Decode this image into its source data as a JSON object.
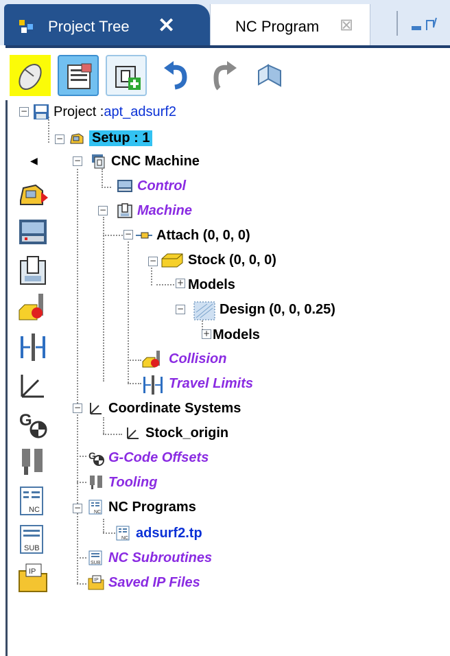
{
  "tabs": [
    {
      "label": "Project Tree",
      "close": "✕",
      "active": true
    },
    {
      "label": "NC Program",
      "close": "⊠",
      "active": false
    }
  ],
  "toolbar": [
    "mouse-select",
    "info",
    "add-machine",
    "undo",
    "redo",
    "shapes"
  ],
  "tree": {
    "project_prefix": "Project : ",
    "project_name": "apt_adsurf2",
    "setup": "Setup : 1",
    "cnc_machine": "CNC Machine",
    "control": "Control",
    "machine": "Machine",
    "attach": "Attach (0, 0, 0)",
    "stock": "Stock (0, 0, 0)",
    "stock_models": "Models",
    "design": "Design (0, 0, 0.25)",
    "design_models": "Models",
    "collision": "Collision",
    "travel_limits": "Travel Limits",
    "coordinate_systems": "Coordinate Systems",
    "stock_origin": "Stock_origin",
    "gcode_offsets": "G-Code Offsets",
    "tooling": "Tooling",
    "nc_programs": "NC Programs",
    "nc_program_file": "adsurf2.tp",
    "nc_subroutines": "NC Subroutines",
    "saved_ip_files": "Saved IP Files"
  },
  "toggles": {
    "expanded": "−",
    "collapsed": "+"
  },
  "palette": {
    "collapse": "◀",
    "items": [
      "setup-icon",
      "control-icon",
      "machine-icon",
      "collision-icon",
      "travel-limits-icon",
      "coordinate-system-icon",
      "gcode-offsets-icon",
      "tooling-icon",
      "nc-programs-icon",
      "nc-subroutines-icon",
      "saved-ip-files-icon"
    ]
  },
  "colors": {
    "tab_active": "#24528f",
    "highlight": "#33c2f2",
    "purple_text": "#8a2be2",
    "blue_text": "#0a31d6",
    "mouse_btn": "#fbfb08"
  }
}
